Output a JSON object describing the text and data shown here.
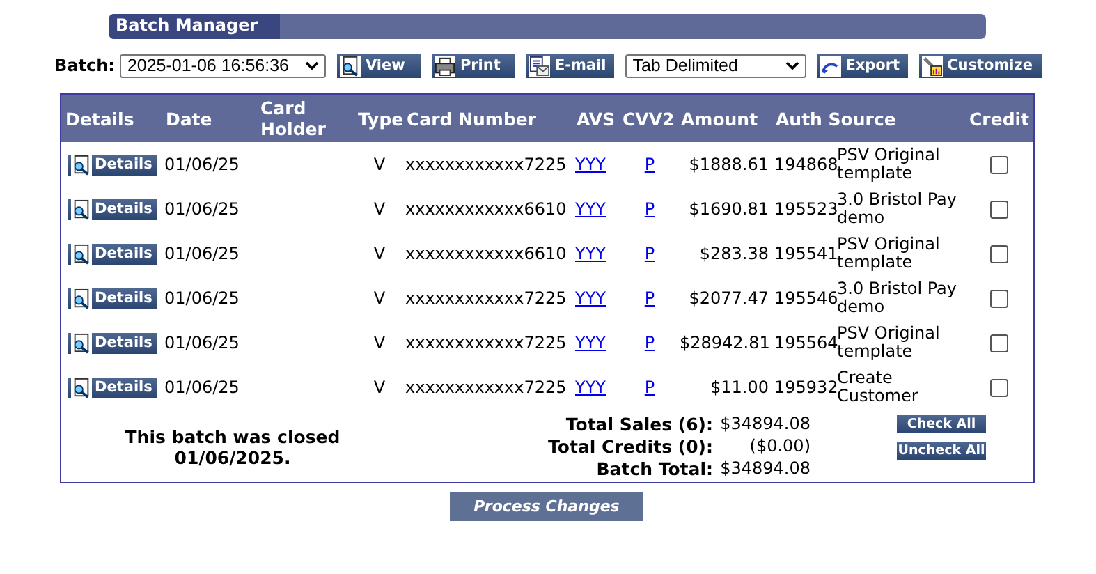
{
  "title": "Batch Manager",
  "toolbar": {
    "batch_label": "Batch:",
    "batch_value": "2025-01-06 16:56:36",
    "view": "View",
    "print": "Print",
    "email": "E-mail",
    "format_value": "Tab Delimited",
    "export": "Export",
    "customize": "Customize"
  },
  "table": {
    "columns": [
      "Details",
      "Date",
      "Card Holder",
      "Type",
      "Card Number",
      "AVS",
      "CVV2",
      "Amount",
      "Auth Source",
      "Credit"
    ],
    "rows": [
      {
        "details": "Details",
        "date": "01/06/25",
        "type": "V",
        "card": "xxxxxxxxxxxx7225",
        "avs": "YYY",
        "cvv2": "P",
        "amount": "$1888.61",
        "auth": "194868",
        "source": "PSV Original template",
        "credit": false
      },
      {
        "details": "Details",
        "date": "01/06/25",
        "type": "V",
        "card": "xxxxxxxxxxxx6610",
        "avs": "YYY",
        "cvv2": "P",
        "amount": "$1690.81",
        "auth": "195523",
        "source": "3.0 Bristol Pay demo",
        "credit": false
      },
      {
        "details": "Details",
        "date": "01/06/25",
        "type": "V",
        "card": "xxxxxxxxxxxx6610",
        "avs": "YYY",
        "cvv2": "P",
        "amount": "$283.38",
        "auth": "195541",
        "source": "PSV Original template",
        "credit": false
      },
      {
        "details": "Details",
        "date": "01/06/25",
        "type": "V",
        "card": "xxxxxxxxxxxx7225",
        "avs": "YYY",
        "cvv2": "P",
        "amount": "$2077.47",
        "auth": "195546",
        "source": "3.0 Bristol Pay demo",
        "credit": false
      },
      {
        "details": "Details",
        "date": "01/06/25",
        "type": "V",
        "card": "xxxxxxxxxxxx7225",
        "avs": "YYY",
        "cvv2": "P",
        "amount": "$28942.81",
        "auth": "195564",
        "source": "PSV Original template",
        "credit": false
      },
      {
        "details": "Details",
        "date": "01/06/25",
        "type": "V",
        "card": "xxxxxxxxxxxx7225",
        "avs": "YYY",
        "cvv2": "P",
        "amount": "$11.00",
        "auth": "195932",
        "source": "Create Customer",
        "credit": false
      }
    ]
  },
  "summary": {
    "closed_note": "This batch was closed 01/06/2025.",
    "totals": [
      {
        "label": "Total Sales (6):",
        "value": "$34894.08"
      },
      {
        "label": "Total Credits (0):",
        "value": "($0.00)"
      },
      {
        "label": "Batch Total:",
        "value": "$34894.08"
      }
    ],
    "check_all": "Check All",
    "uncheck_all": "Uncheck All"
  },
  "process_button": "Process Changes"
}
